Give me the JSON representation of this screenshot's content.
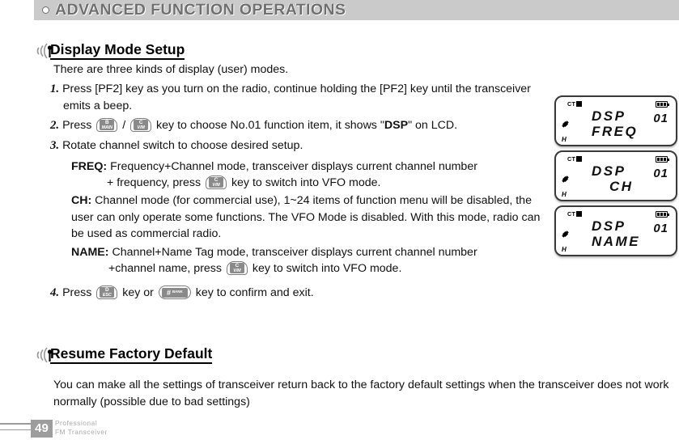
{
  "banner": {
    "title": "ADVANCED FUNCTION OPERATIONS",
    "bullet_icon": "circle-bullet-icon"
  },
  "sections": [
    {
      "id": "display-mode-setup",
      "title": "Display Mode Setup",
      "intro": "There are three kinds of display (user) modes.",
      "steps": [
        {
          "number": "1.",
          "text": "Press [PF2] key as you turn on the radio, continue holding the [PF2] key until the transceiver emits a beep."
        },
        {
          "number": "2.",
          "text_before": "Press ",
          "separator": " / ",
          "text_mid": " key to choose No.01 function item, it shows \"",
          "bold_word": "DSP",
          "text_after": "\" on LCD."
        },
        {
          "number": "3.",
          "text": "Rotate channel switch to choose desired setup."
        },
        {
          "number": "4.",
          "text_before": "Press ",
          "text_mid": " key or ",
          "text_after": " key to confirm and exit."
        }
      ],
      "definitions": [
        {
          "label": "FREQ:",
          "line1": "Frequency+Channel mode, transceiver displays current channel number",
          "line2_before": "+ frequency, press ",
          "line2_after": " key to switch into VFO mode."
        },
        {
          "label": "CH:",
          "body": "Channel mode (for commercial use), 1~24 items of function menu will be disabled, the user can only operate some functions. The VFO Mode is disabled. With this mode, radio can be used as commercial radio."
        },
        {
          "label": "NAME:",
          "line1": "Channel+Name Tag mode, transceiver displays current channel number",
          "line2_before": "+channel name, press ",
          "line2_after": " key to switch into VFO mode."
        }
      ]
    },
    {
      "id": "resume-factory-default",
      "title": "Resume Factory Default",
      "body": "You can make all the settings of transceiver return back to the factory default settings when the transceiver does not work normally  (possible due to bad settings)"
    }
  ],
  "keys": {
    "b_main": {
      "top": "B",
      "bottom": "MAIN"
    },
    "c_vm": {
      "top": "C",
      "bottom": "V/M"
    },
    "d_esc": {
      "top": "D",
      "bottom": "ESC"
    },
    "hash_bank": {
      "symbol": "#",
      "label": "BANK"
    }
  },
  "lcds": [
    {
      "ct_label": "CT",
      "ct_badge": "▪",
      "line1": "DSP",
      "line2": "FREQ",
      "channel": "01",
      "h_mark": "H",
      "battery_icon": "battery-icon",
      "indent_line2": false
    },
    {
      "ct_label": "CT",
      "ct_badge": "▪",
      "line1": "DSP",
      "line2": "CH",
      "channel": "01",
      "h_mark": "H",
      "battery_icon": "battery-icon",
      "indent_line2": true
    },
    {
      "ct_label": "CT",
      "ct_badge": "▪",
      "line1": "DSP",
      "line2": "NAME",
      "channel": "01",
      "h_mark": "H",
      "battery_icon": "battery-icon",
      "indent_line2": false
    }
  ],
  "footer": {
    "page_number": "49",
    "brand_line1": "Professional",
    "brand_line2": "FM Transceiver"
  },
  "colors": {
    "banner_bg": "#cacaca",
    "banner_text": "#6f6f6f",
    "footer_gray": "#9d9d9d",
    "key_pad": "#8a8a8a"
  }
}
